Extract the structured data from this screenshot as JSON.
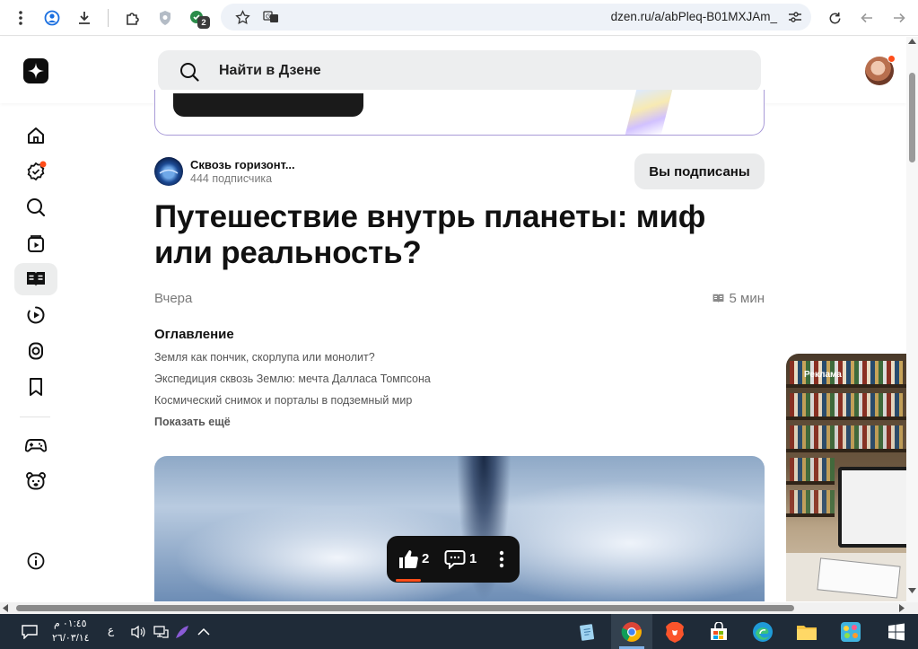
{
  "browser": {
    "url": "dzen.ru/a/abPleq-B01MXJAm_",
    "extensions_badge": "2",
    "icons": [
      "more-vert-icon",
      "profile-sync-icon",
      "download-icon",
      "extensions-icon",
      "shield-extension-icon",
      "badge-extension-icon",
      "bookmark-star-icon",
      "translate-icon",
      "site-settings-icon",
      "reload-icon",
      "back-icon",
      "forward-icon"
    ]
  },
  "header": {
    "search_placeholder": "Найти в Дзене"
  },
  "sidebar": {
    "items": [
      {
        "name": "home",
        "active": false
      },
      {
        "name": "subscriptions",
        "active": false,
        "has_dot": true
      },
      {
        "name": "search",
        "active": false
      },
      {
        "name": "shorts",
        "active": false
      },
      {
        "name": "articles",
        "active": true
      },
      {
        "name": "video",
        "active": false
      },
      {
        "name": "podcasts",
        "active": false
      },
      {
        "name": "bookmarks",
        "active": false
      },
      {
        "name": "games",
        "active": false
      },
      {
        "name": "kids",
        "active": false
      },
      {
        "name": "info",
        "active": false
      }
    ]
  },
  "channel": {
    "name": "Сквозь горизонт...",
    "subscribers": "444 подписчика",
    "subscribe_label": "Вы подписаны"
  },
  "article": {
    "title": "Путешествие внутрь планеты: миф или реальность?",
    "date": "Вчера",
    "read_time": "5 мин",
    "toc_title": "Оглавление",
    "toc_items": [
      "Земля как пончик, скорлупа или монолит?",
      "Экспедиция сквозь Землю: мечта Далласа Томпсона",
      "Космический снимок и порталы в подземный мир"
    ],
    "toc_more": "Показать ещё"
  },
  "reactions": {
    "likes": "2",
    "comments": "1"
  },
  "ad": {
    "label": "Реклама"
  },
  "taskbar": {
    "time": "٠١:٤٥ م",
    "date": "٢٦/٠٣/١٤",
    "language": "ع",
    "apps": [
      "notepad",
      "chrome",
      "brave",
      "store",
      "edge",
      "file-explorer",
      "game-app",
      "start"
    ]
  },
  "colors": {
    "accent": "#ff4d1a",
    "taskbar": "#1f2b38",
    "promo_border": "#a99bd8"
  }
}
